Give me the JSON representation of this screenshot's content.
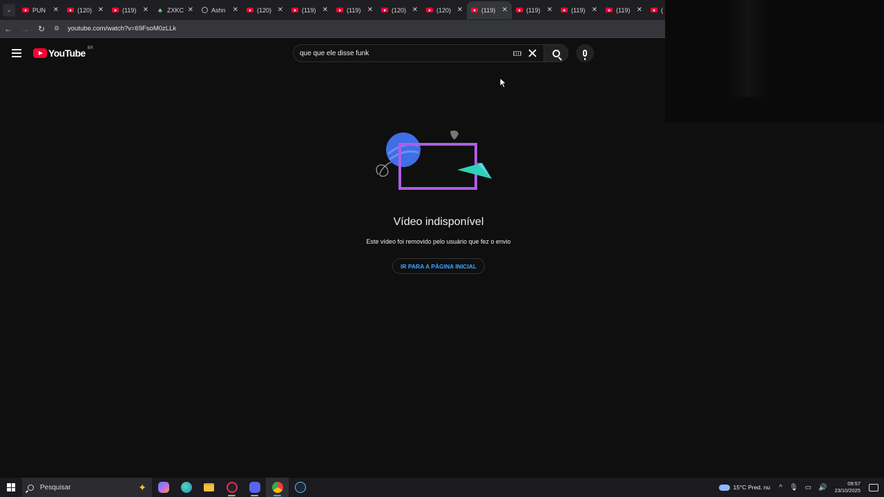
{
  "browser": {
    "tabs": [
      {
        "label": "PUN",
        "favicon": "youtube-icon"
      },
      {
        "label": "(120)",
        "favicon": "youtube-icon"
      },
      {
        "label": "(119)",
        "favicon": "youtube-icon"
      },
      {
        "label": "ZXKC",
        "favicon": "leaf-icon"
      },
      {
        "label": "Ashn",
        "favicon": "globe-icon"
      },
      {
        "label": "(120)",
        "favicon": "youtube-icon"
      },
      {
        "label": "(119)",
        "favicon": "youtube-icon"
      },
      {
        "label": "(119)",
        "favicon": "youtube-icon"
      },
      {
        "label": "(120)",
        "favicon": "youtube-icon"
      },
      {
        "label": "(120)",
        "favicon": "youtube-icon"
      },
      {
        "label": "(119)",
        "favicon": "youtube-icon",
        "active": true
      },
      {
        "label": "(119)",
        "favicon": "youtube-icon"
      },
      {
        "label": "(119)",
        "favicon": "youtube-icon"
      },
      {
        "label": "(119)",
        "favicon": "youtube-icon"
      },
      {
        "label": "(",
        "favicon": "youtube-icon"
      }
    ],
    "url": "youtube.com/watch?v=69FsoM0zLLk"
  },
  "youtube": {
    "logo_text": "YouTube",
    "country_code": "BR",
    "search_value": "que que ele disse funk",
    "brand_color": "#ff0033"
  },
  "main": {
    "title": "Vídeo indisponível",
    "subtitle": "Este vídeo foi removido pelo usuário que fez o envio",
    "home_button": "IR PARA A PÁGINA INICIAL"
  },
  "taskbar": {
    "search_placeholder": "Pesquisar",
    "apps": [
      "copilot-icon",
      "edge-icon",
      "file-explorer-icon",
      "media-app-icon",
      "discord-icon",
      "chrome-icon",
      "steam-icon"
    ],
    "weather": "15°C  Pred. nu",
    "time": "09:57",
    "date": "23/10/2025"
  }
}
